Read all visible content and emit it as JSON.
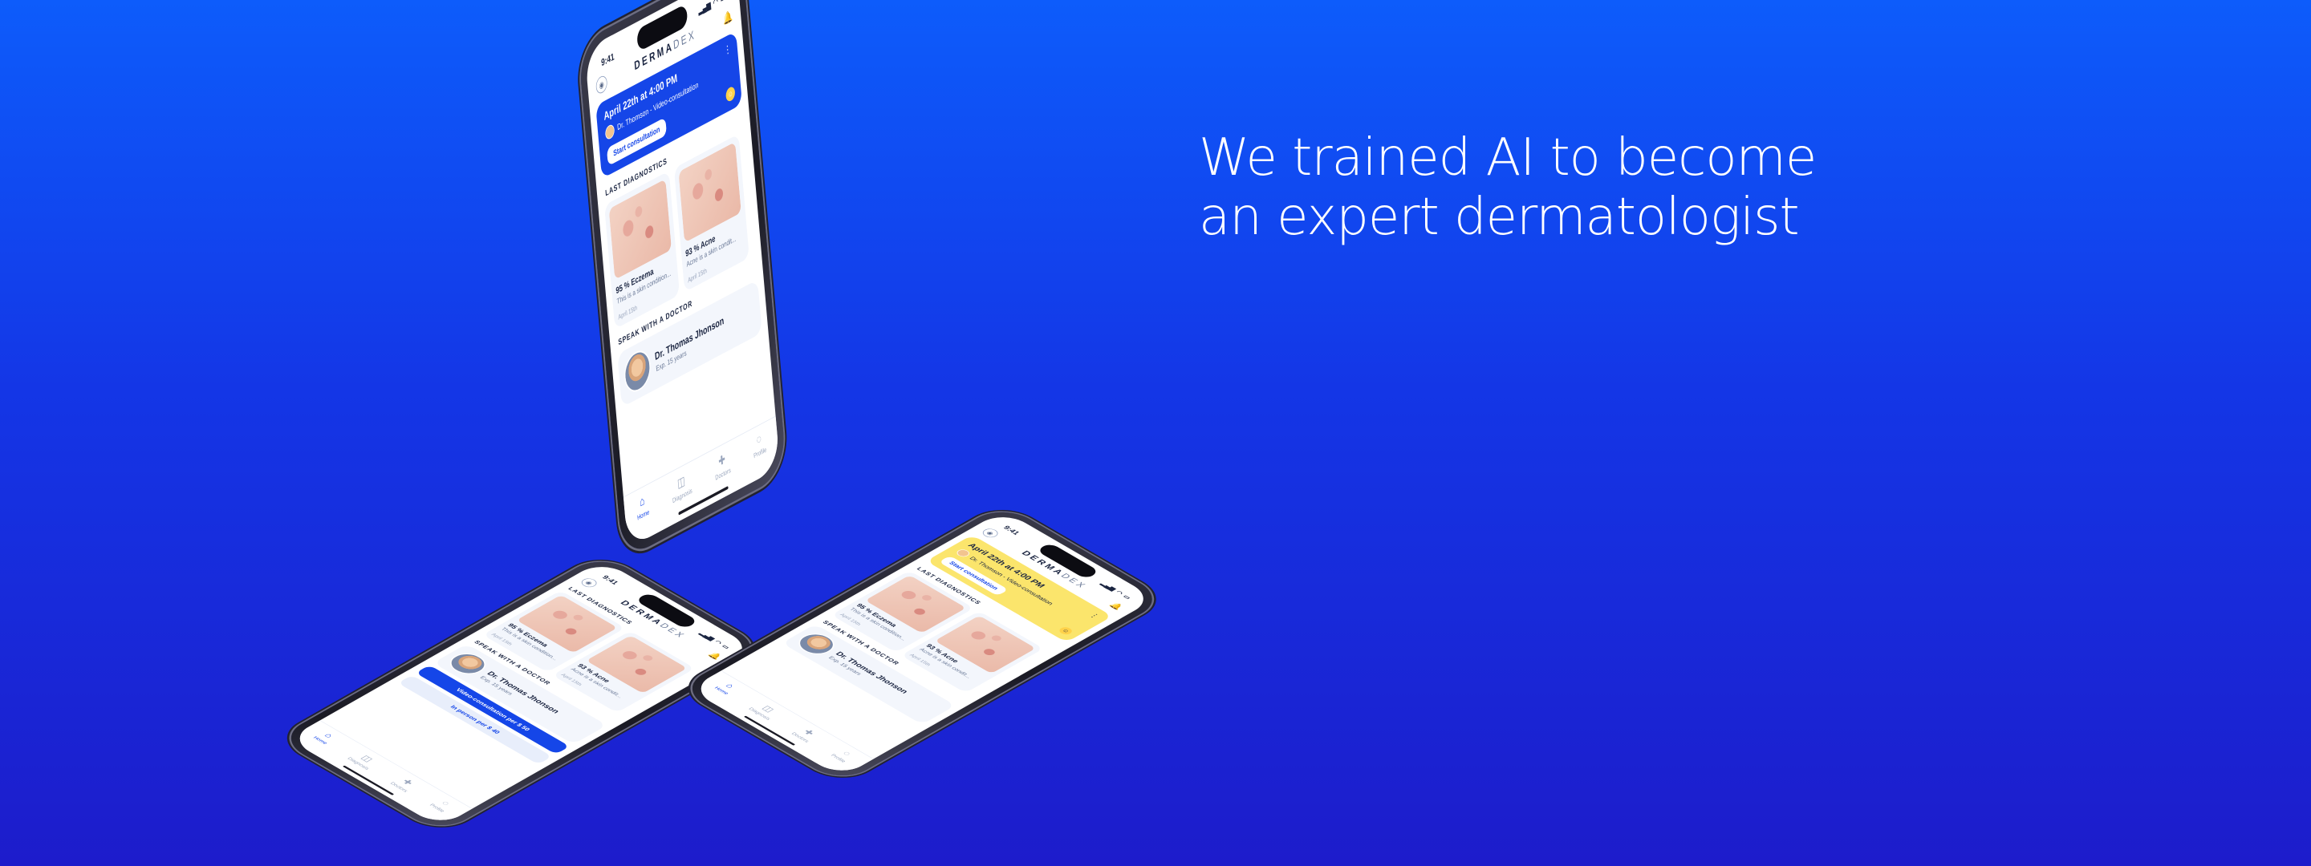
{
  "headline": {
    "line1": "We trained AI to become",
    "line2": "an expert dermatologist"
  },
  "app": {
    "status_time": "9:41",
    "logo_main": "DERMA",
    "logo_suffix": "DEX",
    "icons": {
      "signal": "signal-icon",
      "wifi": "wifi-icon",
      "battery": "battery-icon",
      "profile": "profile-icon",
      "bell": "bell-icon",
      "more": "more-icon"
    },
    "appointment": {
      "date": "April 22th at 4:00 PM",
      "doctor": "Dr. Thomson - Video-consultation",
      "action": "Start consultation"
    },
    "last_diagnostics": {
      "title": "LAST DIAGNOSTICS",
      "items": [
        {
          "name": "95 % Eczema",
          "desc": "This is a skin condition...",
          "date": "April 15th"
        },
        {
          "name": "93 % Acne",
          "desc": "Acne is a skin condit...",
          "date": "April 15th"
        }
      ]
    },
    "speak_with_doctor": {
      "title": "SPEAK WITH A DOCTOR",
      "doctor_name": "Dr. Thomas Jhonson",
      "experience": "Exp. 15 years",
      "video_btn": "Video-consultation per $ 50",
      "inperson_btn": "In person per $ 40"
    },
    "tabs": [
      "Home",
      "Diagnosis",
      "Doctors",
      "Profile"
    ]
  },
  "colors": {
    "accent": "#1546e8",
    "yellow_card": "#fbe56c",
    "bg_top": "#0d5cfb",
    "bg_bottom": "#1d1ccb"
  }
}
